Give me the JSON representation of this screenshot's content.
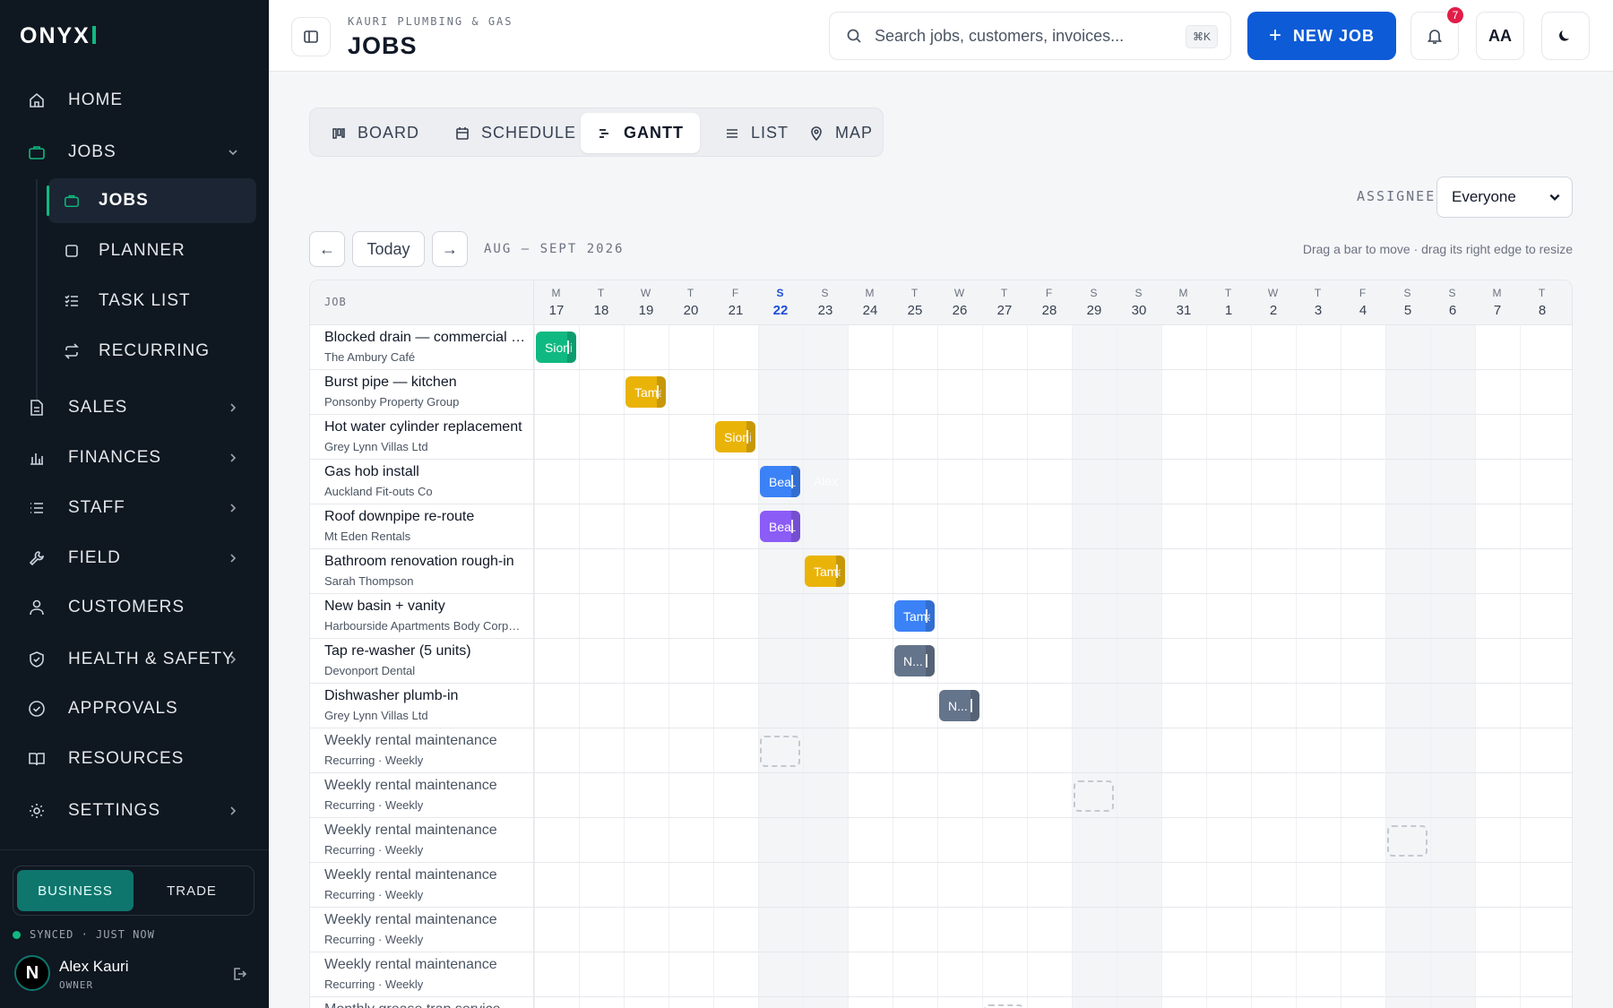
{
  "app": {
    "logo": "ONYX"
  },
  "sidebar": {
    "nav": [
      {
        "label": "HOME",
        "icon": "home-icon"
      },
      {
        "label": "JOBS",
        "icon": "briefcase-icon",
        "expanded": true
      },
      {
        "label": "SALES",
        "icon": "document-icon"
      },
      {
        "label": "FINANCES",
        "icon": "bar-chart-icon"
      },
      {
        "label": "STAFF",
        "icon": "list-icon"
      },
      {
        "label": "FIELD",
        "icon": "wrench-icon"
      },
      {
        "label": "CUSTOMERS",
        "icon": "person-icon"
      },
      {
        "label": "HEALTH & SAFETY",
        "icon": "shield-icon"
      },
      {
        "label": "APPROVALS",
        "icon": "check-circle-icon"
      },
      {
        "label": "RESOURCES",
        "icon": "book-icon"
      },
      {
        "label": "SETTINGS",
        "icon": "sun-gear-icon"
      }
    ],
    "jobs_sub": [
      {
        "label": "JOBS",
        "icon": "briefcase-icon",
        "active": true
      },
      {
        "label": "PLANNER",
        "icon": "square-icon"
      },
      {
        "label": "TASK LIST",
        "icon": "checklist-icon"
      },
      {
        "label": "RECURRING",
        "icon": "repeat-icon"
      }
    ],
    "mode": {
      "business": "BUSINESS",
      "trade": "TRADE",
      "selected": "BUSINESS"
    },
    "sync_status": "SYNCED · JUST NOW",
    "user": {
      "initial": "N",
      "name": "Alex Kauri",
      "role": "OWNER"
    }
  },
  "header": {
    "breadcrumb": "KAURI PLUMBING & GAS",
    "title": "JOBS",
    "search_placeholder": "Search jobs, customers, invoices...",
    "search_shortcut": "⌘K",
    "new_job_plus": "+",
    "new_job_label": "NEW JOB",
    "notification_count": "7",
    "text_size_label": "AA"
  },
  "view_tabs": [
    {
      "label": "BOARD",
      "icon": "board-icon"
    },
    {
      "label": "SCHEDULE",
      "icon": "calendar-icon"
    },
    {
      "label": "GANTT",
      "icon": "gantt-icon",
      "active": true
    },
    {
      "label": "LIST",
      "icon": "list-icon"
    },
    {
      "label": "MAP",
      "icon": "map-pin-icon"
    }
  ],
  "filter": {
    "label": "ASSIGNEE",
    "value": "Everyone"
  },
  "nav": {
    "prev": "←",
    "today": "Today",
    "next": "→",
    "range": "AUG – SEPT 2026",
    "hint": "Drag a bar to move · drag its right edge to resize"
  },
  "gantt": {
    "job_header": "JOB",
    "days": [
      {
        "dow": "M",
        "num": "17"
      },
      {
        "dow": "T",
        "num": "18"
      },
      {
        "dow": "W",
        "num": "19"
      },
      {
        "dow": "T",
        "num": "20"
      },
      {
        "dow": "F",
        "num": "21"
      },
      {
        "dow": "S",
        "num": "22",
        "today": true,
        "weekend": true
      },
      {
        "dow": "S",
        "num": "23",
        "weekend": true
      },
      {
        "dow": "M",
        "num": "24"
      },
      {
        "dow": "T",
        "num": "25"
      },
      {
        "dow": "W",
        "num": "26"
      },
      {
        "dow": "T",
        "num": "27"
      },
      {
        "dow": "F",
        "num": "28"
      },
      {
        "dow": "S",
        "num": "29",
        "weekend": true
      },
      {
        "dow": "S",
        "num": "30",
        "weekend": true
      },
      {
        "dow": "M",
        "num": "31"
      },
      {
        "dow": "T",
        "num": "1"
      },
      {
        "dow": "W",
        "num": "2"
      },
      {
        "dow": "T",
        "num": "3"
      },
      {
        "dow": "F",
        "num": "4"
      },
      {
        "dow": "S",
        "num": "5",
        "weekend": true
      },
      {
        "dow": "S",
        "num": "6",
        "weekend": true
      },
      {
        "dow": "M",
        "num": "7"
      },
      {
        "dow": "T",
        "num": "8"
      }
    ],
    "rows": [
      {
        "title": "Blocked drain — commercial kitchen",
        "customer": "The Ambury Café",
        "day_index": 0,
        "label": "Sioni",
        "color": "#10b981"
      },
      {
        "title": "Burst pipe — kitchen",
        "customer": "Ponsonby Property Group",
        "day_index": 2,
        "label": "Tama",
        "color": "#eab308"
      },
      {
        "title": "Hot water cylinder replacement",
        "customer": "Grey Lynn Villas Ltd",
        "day_index": 4,
        "label": "Sioni",
        "color": "#eab308"
      },
      {
        "title": "Gas hob install",
        "customer": "Auckland Fit-outs Co",
        "day_index": 5,
        "label": "Beau",
        "extra": "Alex",
        "color": "#3b82f6"
      },
      {
        "title": "Roof downpipe re-route",
        "customer": "Mt Eden Rentals",
        "day_index": 5,
        "label": "Beau",
        "color": "#8b5cf6"
      },
      {
        "title": "Bathroom renovation rough-in",
        "customer": "Sarah Thompson",
        "day_index": 6,
        "label": "Tama",
        "color": "#eab308"
      },
      {
        "title": "New basin + vanity",
        "customer": "Harbourside Apartments Body Corporate",
        "day_index": 8,
        "label": "Tama",
        "color": "#3b82f6"
      },
      {
        "title": "Tap re-washer (5 units)",
        "customer": "Devonport Dental",
        "day_index": 8,
        "label": "N...",
        "color": "#64748b"
      },
      {
        "title": "Dishwasher plumb-in",
        "customer": "Grey Lynn Villas Ltd",
        "day_index": 9,
        "label": "N...",
        "color": "#64748b"
      },
      {
        "title": "Weekly rental maintenance",
        "customer": "Recurring · Weekly",
        "day_index": 5,
        "recurring": true
      },
      {
        "title": "Weekly rental maintenance",
        "customer": "Recurring · Weekly",
        "day_index": 12,
        "recurring": true
      },
      {
        "title": "Weekly rental maintenance",
        "customer": "Recurring · Weekly",
        "day_index": 19,
        "recurring": true
      },
      {
        "title": "Weekly rental maintenance",
        "customer": "Recurring · Weekly",
        "recurring": true
      },
      {
        "title": "Weekly rental maintenance",
        "customer": "Recurring · Weekly",
        "recurring": true
      },
      {
        "title": "Weekly rental maintenance",
        "customer": "Recurring · Weekly",
        "recurring": true
      },
      {
        "title": "Monthly grease trap service",
        "customer": "",
        "day_index": 10,
        "recurring": true
      }
    ]
  }
}
